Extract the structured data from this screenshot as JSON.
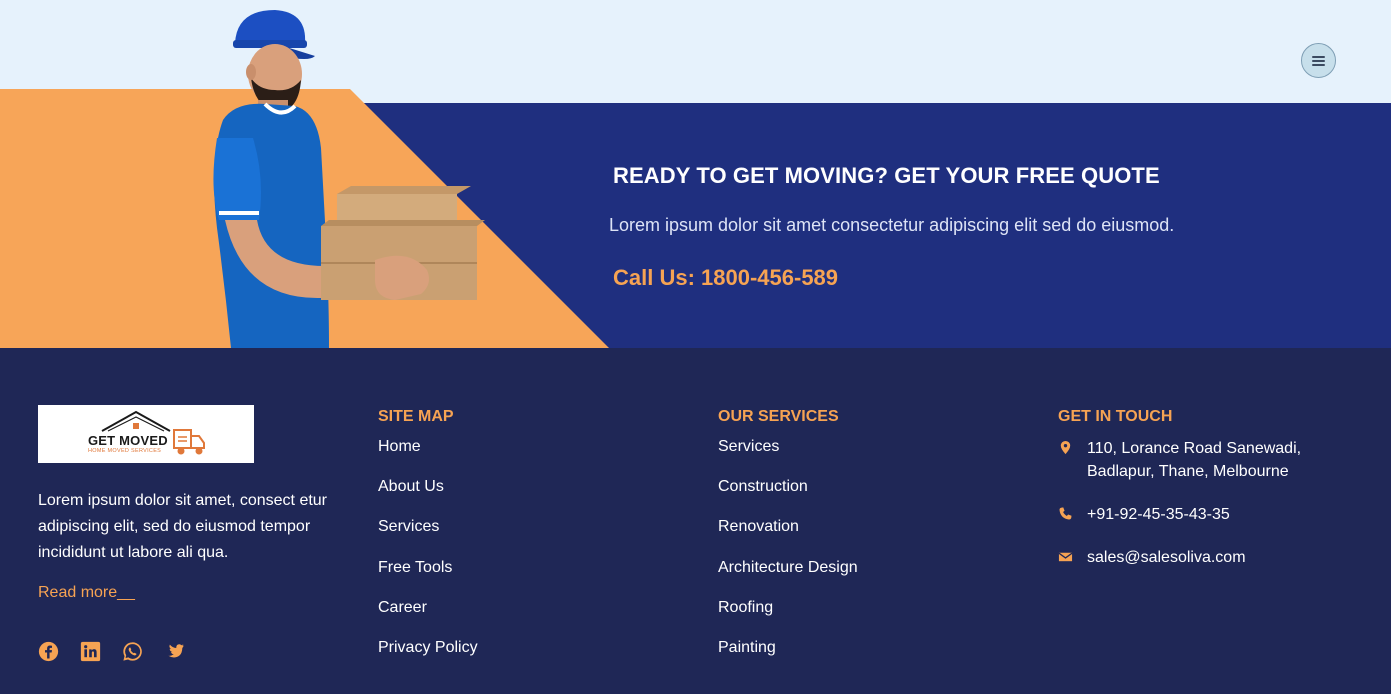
{
  "colors": {
    "accent": "#f6a353",
    "navy": "#1f2f7f",
    "footer_bg": "#1f2756",
    "sky": "#e6f2fc"
  },
  "header": {
    "menu_icon": "hamburger-icon"
  },
  "cta": {
    "title": "READY TO GET MOVING? GET YOUR FREE QUOTE",
    "text": "Lorem ipsum dolor sit amet consectetur adipiscing elit sed do eiusmod.",
    "call": "Call Us: 1800-456-589"
  },
  "footer": {
    "logo": {
      "title": "GET MOVED",
      "subtitle": "HOME MOVED SERVICES"
    },
    "about": "Lorem ipsum dolor sit amet, consect etur adipiscing elit, sed do eiusmod tempor incididunt ut labore ali qua.",
    "read_more": "Read more__",
    "socials": [
      "facebook-icon",
      "linkedin-icon",
      "whatsapp-icon",
      "twitter-icon"
    ],
    "sitemap": {
      "heading": "SITE MAP",
      "items": [
        "Home",
        "About Us",
        "Services",
        "Free Tools",
        "Career",
        "Privacy Policy"
      ]
    },
    "services": {
      "heading": "OUR SERVICES",
      "items": [
        "Services",
        "Construction",
        "Renovation",
        "Architecture Design",
        "Roofing",
        "Painting"
      ]
    },
    "contact": {
      "heading": "GET IN TOUCH",
      "address": "110, Lorance Road Sanewadi, Badlapur, Thane, Melbourne",
      "phone": "+91-92-45-35-43-35",
      "email": "sales@salesoliva.com"
    }
  }
}
